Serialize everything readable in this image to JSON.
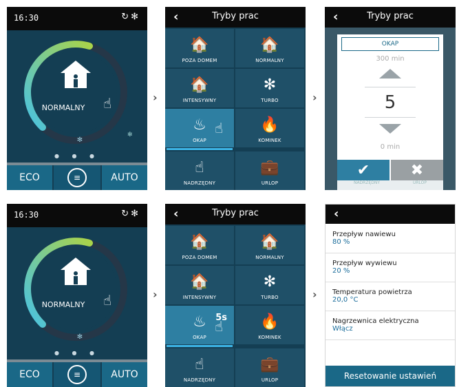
{
  "home": {
    "time": "16:30",
    "mode_label": "NORMALNY",
    "eco_label": "ECO",
    "auto_label": "AUTO",
    "status_icons": "refresh-icon fan-icon"
  },
  "modes": {
    "title": "Tryby prac",
    "items": [
      {
        "label": "POZA DOMEM",
        "icon": "person-leaving-house-icon"
      },
      {
        "label": "NORMALNY",
        "icon": "person-in-house-icon"
      },
      {
        "label": "INTENSYWNY",
        "icon": "group-in-house-icon"
      },
      {
        "label": "TURBO",
        "icon": "turbo-fan-icon"
      },
      {
        "label": "OKAP",
        "icon": "cooking-pot-icon"
      },
      {
        "label": "KOMINEK",
        "icon": "fireplace-icon"
      },
      {
        "label": "NADRZĘDNY",
        "icon": "hand-touch-icon"
      },
      {
        "label": "URLOP",
        "icon": "suitcase-icon"
      }
    ],
    "hold_badge": "5s"
  },
  "popup": {
    "title": "OKAP",
    "max": "300 min",
    "value": "5",
    "min": "0 min",
    "under_left": "NADRZĘDNY",
    "under_right": "URLOP"
  },
  "settings": {
    "items": [
      {
        "name": "Przepływ nawiewu",
        "value": "80 %"
      },
      {
        "name": "Przepływ wywiewu",
        "value": "20 %"
      },
      {
        "name": "Temperatura powietrza",
        "value": "20,0 °C"
      },
      {
        "name": "Nagrzewnica elektryczna",
        "value": "Włącz"
      }
    ],
    "reset_label": "Resetowanie ustawień"
  },
  "colors": {
    "screen_bg": "#143e53",
    "accent": "#1a6887",
    "active_tile": "#2e7fa2",
    "arc_start": "#49c2e3",
    "arc_end": "#a9d34a"
  }
}
